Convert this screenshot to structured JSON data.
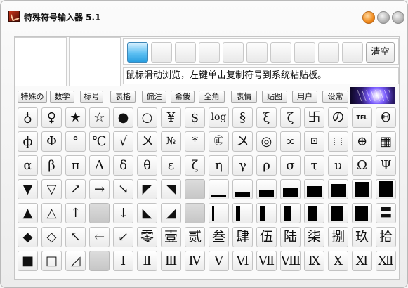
{
  "window": {
    "title": "特殊符号输入器 5.1"
  },
  "toolbar": {
    "clear_label": "清空"
  },
  "hint": "鼠标滑动浏览，左键单击复制符号到系统粘贴板。",
  "tabs": [
    "特殊の",
    "数学",
    "标号",
    "表格",
    "偏注",
    "希俄",
    "全角",
    "表情",
    "贴图",
    "用户",
    "设常"
  ],
  "grid": {
    "row1": [
      "♁",
      "♀",
      "★",
      "☆",
      "●",
      "○",
      "¥",
      "$",
      "log",
      "§",
      "ξ",
      "ζ",
      "卐",
      "の",
      "TEL",
      "Θ"
    ],
    "row2": [
      "ф",
      "Φ",
      "°",
      "℃",
      "√",
      "〤",
      "№",
      "*",
      "㊣",
      "〤",
      "◎",
      "∞",
      "⊡",
      "⬚",
      "⊕",
      "▦"
    ],
    "row3": [
      "α",
      "β",
      "π",
      "Δ",
      "δ",
      "θ",
      "ε",
      "ζ",
      "η",
      "γ",
      "ρ",
      "σ",
      "τ",
      "υ",
      "Ω",
      "Ψ"
    ],
    "row4": [
      "▼",
      "▽",
      "↗",
      "→",
      "↘",
      "◤",
      "◥",
      "",
      "▁",
      "▂",
      "▃",
      "▄",
      "▅",
      "▆",
      "▇",
      "█"
    ],
    "row5": [
      "▲",
      "△",
      "↑",
      "",
      "↓",
      "◣",
      "◢",
      "",
      "▏",
      "▎",
      "▍",
      "▌",
      "▋",
      "▊",
      "▉",
      "〓"
    ],
    "row6": [
      "◆",
      "◇",
      "↖",
      "←",
      "↙",
      "零",
      "壹",
      "贰",
      "叁",
      "肆",
      "伍",
      "陆",
      "柒",
      "捌",
      "玖",
      "拾"
    ],
    "row7": [
      "■",
      "□",
      "◿",
      "",
      "Ⅰ",
      "Ⅱ",
      "Ⅲ",
      "Ⅳ",
      "Ⅴ",
      "Ⅵ",
      "Ⅶ",
      "Ⅷ",
      "Ⅸ",
      "Ⅹ",
      "Ⅺ",
      "Ⅻ"
    ]
  }
}
